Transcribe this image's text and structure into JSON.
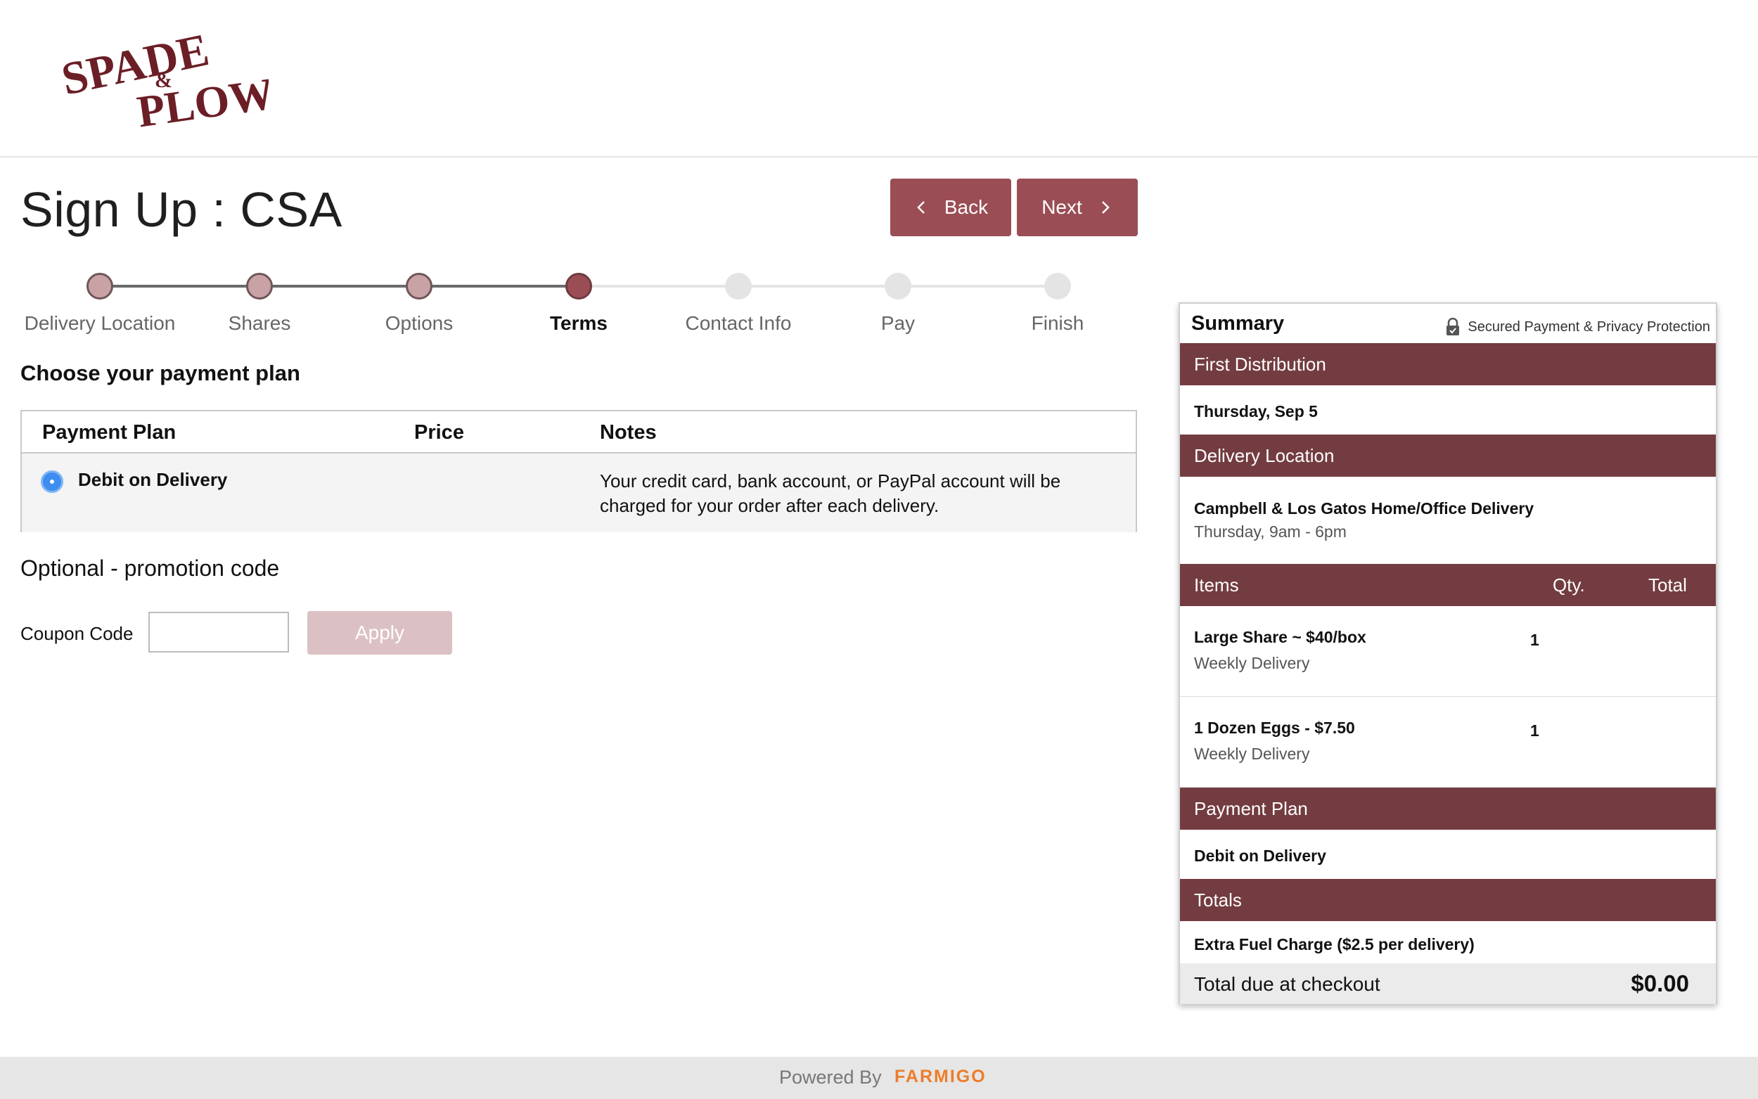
{
  "brand": {
    "logo_text": "SPADE & PLOW",
    "logo_top": "SPADE",
    "logo_amp": "&",
    "logo_bottom": "PLOW"
  },
  "page": {
    "title": "Sign Up : CSA"
  },
  "buttons": {
    "back": "Back",
    "next": "Next",
    "apply": "Apply"
  },
  "steps": [
    {
      "label": "Delivery Location",
      "state": "done"
    },
    {
      "label": "Shares",
      "state": "done"
    },
    {
      "label": "Options",
      "state": "done"
    },
    {
      "label": "Terms",
      "state": "active"
    },
    {
      "label": "Contact Info",
      "state": "pending"
    },
    {
      "label": "Pay",
      "state": "pending"
    },
    {
      "label": "Finish",
      "state": "pending"
    }
  ],
  "payment": {
    "heading": "Choose your payment plan",
    "columns": {
      "plan": "Payment Plan",
      "price": "Price",
      "notes": "Notes"
    },
    "rows": [
      {
        "name": "Debit on Delivery",
        "price": "",
        "notes": "Your credit card, bank account, or PayPal account will be charged for your order after each delivery.",
        "selected": true
      }
    ]
  },
  "promo": {
    "heading": "Optional - promotion code",
    "coupon_label": "Coupon Code",
    "coupon_value": ""
  },
  "summary": {
    "title": "Summary",
    "secure_text": "Secured Payment & Privacy Protection",
    "first_distribution": {
      "label": "First Distribution",
      "value": "Thursday, Sep 5"
    },
    "delivery_location": {
      "label": "Delivery Location",
      "name": "Campbell & Los Gatos Home/Office Delivery",
      "hours": "Thursday, 9am - 6pm"
    },
    "items_header": {
      "items": "Items",
      "qty": "Qty.",
      "total": "Total"
    },
    "items": [
      {
        "name": "Large Share ~ $40/box",
        "frequency": "Weekly Delivery",
        "qty": "1"
      },
      {
        "name": "1 Dozen Eggs - $7.50",
        "frequency": "Weekly Delivery",
        "qty": "1"
      }
    ],
    "payment_plan": {
      "label": "Payment Plan",
      "value": "Debit on Delivery"
    },
    "totals": {
      "label": "Totals",
      "fuel_charge": "Extra Fuel Charge ($2.5 per delivery)",
      "due_label": "Total due at checkout",
      "due_value": "$0.00"
    }
  },
  "footer": {
    "powered_by": "Powered By",
    "brand": "FARMIGO"
  },
  "colors": {
    "primary": "#9b4d55",
    "band": "#733c40",
    "step_done": "#c9a2a6",
    "step_active": "#9b4d55",
    "step_pending": "#e4e4e4",
    "footer_brand": "#ee7c2a"
  }
}
